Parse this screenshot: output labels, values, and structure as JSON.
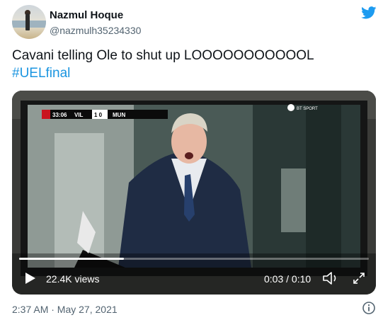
{
  "author": {
    "name": "Nazmul Hoque",
    "handle": "@nazmulh35234330"
  },
  "tweet": {
    "text": "Cavani telling Ole to shut up LOOOOOOOOOOOL",
    "hashtag": "#UELfinal"
  },
  "video": {
    "views": "22.4K views",
    "time": "0:03 / 0:10",
    "progress": 0.3,
    "scoreboard": {
      "clock": "33:06",
      "home": "VIL",
      "score": "1 0",
      "away": "MUN"
    },
    "broadcaster": "BT SPORT"
  },
  "meta": {
    "timestamp": "2:37 AM · May 27, 2021"
  },
  "colors": {
    "accent": "#1b95e0",
    "brand_twitter": "#1d9bf0",
    "muted": "#536471"
  },
  "icons": [
    "twitter-bird-icon",
    "play-icon",
    "volume-icon",
    "fullscreen-icon",
    "info-icon"
  ]
}
